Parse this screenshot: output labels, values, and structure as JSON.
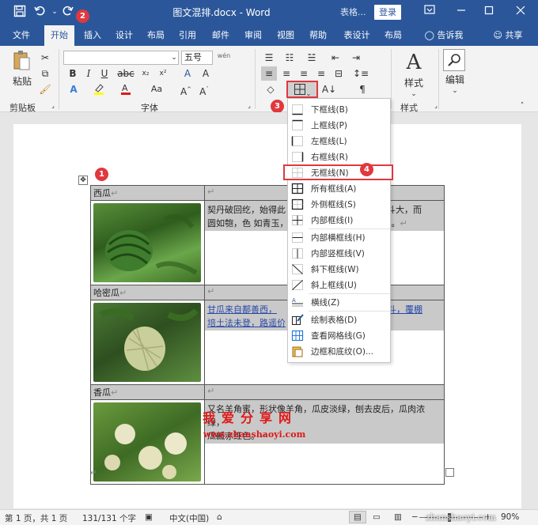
{
  "title": {
    "doc_name": "图文混排.docx",
    "separator": " - ",
    "app": "Word",
    "table_tools": "表格...",
    "login": "登录"
  },
  "tabs": [
    "文件",
    "开始",
    "插入",
    "设计",
    "布局",
    "引用",
    "邮件",
    "审阅",
    "视图",
    "帮助",
    "表设计",
    "布局",
    "告诉我",
    "共享"
  ],
  "ribbon": {
    "paste_label": "粘贴",
    "clipboard_group": "剪贴板",
    "font_group": "字体",
    "font_size": "五号",
    "wen_label": "wén",
    "styles_label": "样式",
    "styles_group": "样式",
    "edit_label": "编辑"
  },
  "markers": [
    "1",
    "2",
    "3",
    "4"
  ],
  "table": {
    "rows": [
      {
        "name": "西瓜",
        "desc_parts": [
          {
            "text": "契丹破回纥，始得此",
            "style": "plain"
          },
          {
            "text": "种，以牛粪覆而种之。结实如斗大，而圆如匏，色 如青玉，子如金色，或黑麻色。北地多有之。",
            "style": "plain"
          }
        ],
        "desc_short": "契丹破回纥，始得此",
        "desc_right": "实如斗大，而",
        "desc_line2": "圆如匏，色 如青玉，",
        "desc_line2_right": "地多有之。"
      },
      {
        "name": "哈密瓜",
        "desc_line1": "甘瓜来自鄯善西，",
        "desc_line1_right": "大如斗，覆棚",
        "desc_line2": "培土法未登，路遥价"
      },
      {
        "name": "香瓜",
        "desc_line1": "又名羊角蜜，形状像羊角，瓜皮淡绿，刨去皮后，瓜肉浓绿，",
        "desc_line2": "瓜瓤赤红色。"
      }
    ],
    "pilcrow": "↵"
  },
  "menu": {
    "items": [
      {
        "label": "下框线(B)",
        "icon": "border-bottom-icon"
      },
      {
        "label": "上框线(P)",
        "icon": "border-top-icon"
      },
      {
        "label": "左框线(L)",
        "icon": "border-left-icon"
      },
      {
        "label": "右框线(R)",
        "icon": "border-right-icon"
      },
      {
        "label": "无框线(N)",
        "icon": "border-none-icon"
      },
      {
        "label": "所有框线(A)",
        "icon": "border-all-icon"
      },
      {
        "label": "外侧框线(S)",
        "icon": "border-outside-icon"
      },
      {
        "label": "内部框线(I)",
        "icon": "border-inside-icon"
      },
      {
        "label": "内部横框线(H)",
        "icon": "border-inside-horizontal-icon"
      },
      {
        "label": "内部竖框线(V)",
        "icon": "border-inside-vertical-icon"
      },
      {
        "label": "斜下框线(W)",
        "icon": "diagonal-down-icon"
      },
      {
        "label": "斜上框线(U)",
        "icon": "diagonal-up-icon"
      },
      {
        "label": "横线(Z)",
        "icon": "horizontal-line-icon"
      },
      {
        "label": "绘制表格(D)",
        "icon": "draw-table-icon"
      },
      {
        "label": "查看网格线(G)",
        "icon": "view-gridlines-icon"
      },
      {
        "label": "边框和底纹(O)...",
        "icon": "borders-shading-icon"
      }
    ]
  },
  "watermark": {
    "text": "我爱分享网",
    "url": "www.zhanshaoyi.com",
    "corner_url": "zhanshaoyi.com"
  },
  "status": {
    "page": "第 1 页，共 1 页",
    "words": "131/131 个字",
    "lang": "中文(中国)",
    "zoom": "90%"
  },
  "colors": {
    "word_blue": "#2b579a",
    "marker_red": "#e0383e",
    "highlight_red": "#e0383e"
  }
}
